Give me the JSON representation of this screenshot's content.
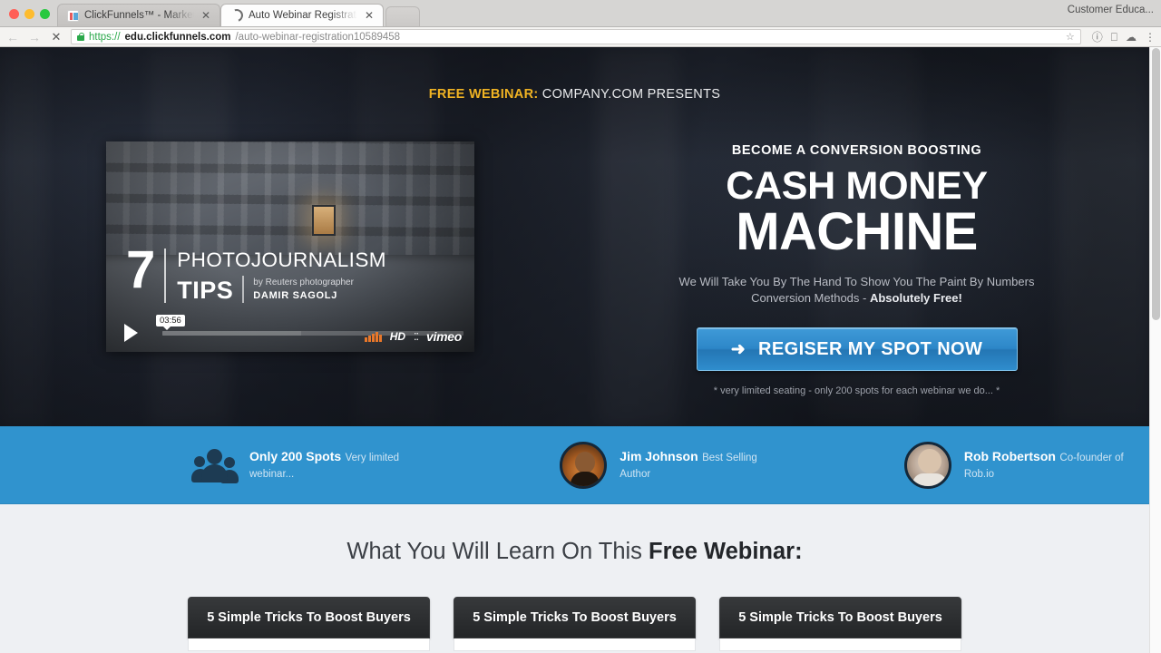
{
  "browser": {
    "traffic_lights": [
      "close",
      "minimize",
      "zoom"
    ],
    "tabs": [
      {
        "title": "ClickFunnels™ - Marketing F",
        "favicon": "clickfunnels-favicon",
        "active": false,
        "close_label": "✕"
      },
      {
        "title": "Auto Webinar Registration",
        "favicon": "loading-spinner-icon",
        "active": true,
        "close_label": "✕"
      }
    ],
    "profile_label": "Customer Educa...",
    "nav": {
      "back": "←",
      "forward": "→",
      "stop": "✕"
    },
    "url": {
      "scheme": "https://",
      "domain": "edu.clickfunnels.com",
      "path": "/auto-webinar-registration10589458"
    },
    "toolbar_icons": [
      "star-icon",
      "info-icon",
      "extension-icon",
      "cloud-icon",
      "menu-icon"
    ],
    "star": "☆"
  },
  "hero": {
    "eyebrow_highlight": "FREE WEBINAR:",
    "eyebrow_rest": " COMPANY.COM PRESENTS",
    "pre_headline": "BECOME A CONVERSION BOOSTING",
    "headline_line1": "CASH MONEY",
    "headline_line2": "MACHINE",
    "subheadline_text": "We Will Take You By The Hand To Show You The Paint By Numbers Conversion Methods - ",
    "subheadline_bold": "Absolutely Free!",
    "cta_arrow": "➜",
    "cta_label": "REGISER MY SPOT NOW",
    "cta_color": "#2d87c8",
    "fineprint": "* very limited seating - only 200 spots for each webinar we do... *"
  },
  "video": {
    "number": "7",
    "title_line1": "PHOTOJOURNALISM",
    "title_line2": "TIPS",
    "credit_line1": "by Reuters photographer",
    "credit_line2": "DAMIR SAGOLJ",
    "timestamp": "03:56",
    "quality_label": "HD",
    "fullscreen_icon": "⁚⁚",
    "provider": "vimeo",
    "play_label": "play"
  },
  "bluebar": {
    "background": "#3093ce",
    "items": [
      {
        "icon": "people-group-icon",
        "name": "Only 200 Spots",
        "desc": "Very limited webinar..."
      },
      {
        "icon": "avatar-jim",
        "name": "Jim Johnson",
        "desc": "Best Selling Author"
      },
      {
        "icon": "avatar-rob",
        "name": "Rob Robertson",
        "desc": "Co-founder of Rob.io"
      }
    ]
  },
  "lower": {
    "heading_normal": "What You Will Learn On This ",
    "heading_bold": "Free Webinar:",
    "cards": [
      {
        "title": "5 Simple Tricks To Boost Buyers"
      },
      {
        "title": "5 Simple Tricks To Boost Buyers"
      },
      {
        "title": "5 Simple Tricks To Boost Buyers"
      }
    ]
  }
}
